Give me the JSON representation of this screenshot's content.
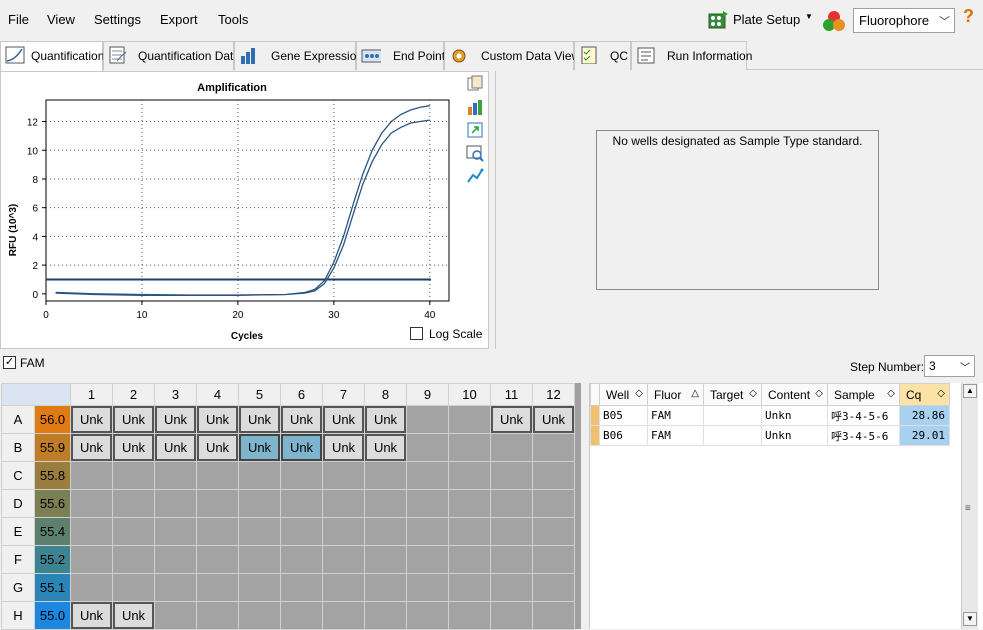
{
  "menu": {
    "file": "File",
    "view": "View",
    "settings": "Settings",
    "export": "Export",
    "tools": "Tools"
  },
  "toolbar": {
    "plate_setup": "Plate Setup",
    "fluorophore": "Fluorophore",
    "help": "?"
  },
  "tabs": [
    {
      "label": "Quantification"
    },
    {
      "label": "Quantification Data"
    },
    {
      "label": "Gene Expression"
    },
    {
      "label": "End Point"
    },
    {
      "label": "Custom Data View"
    },
    {
      "label": "QC"
    },
    {
      "label": "Run Information"
    }
  ],
  "chart": {
    "log_scale_label": "Log Scale"
  },
  "chart_data": {
    "type": "line",
    "title": "Amplification",
    "xlabel": "Cycles",
    "ylabel": "RFU (10^3)",
    "xlim": [
      0,
      42
    ],
    "ylim": [
      -0.5,
      13.5
    ],
    "xticks": [
      0,
      10,
      20,
      30,
      40
    ],
    "yticks": [
      0,
      2,
      4,
      6,
      8,
      10,
      12
    ],
    "threshold": 1.0,
    "series": [
      {
        "x": [
          1,
          5,
          10,
          15,
          20,
          25,
          27,
          28,
          29,
          30,
          31,
          32,
          33,
          34,
          35,
          36,
          37,
          38,
          39,
          40
        ],
        "y": [
          0.05,
          -0.05,
          -0.1,
          -0.1,
          -0.1,
          -0.05,
          0.1,
          0.3,
          0.9,
          2.2,
          4.0,
          6.2,
          8.3,
          10.0,
          11.2,
          12.0,
          12.5,
          12.8,
          13.0,
          13.1
        ]
      },
      {
        "x": [
          1,
          5,
          10,
          15,
          20,
          25,
          27,
          28,
          29,
          30,
          31,
          32,
          33,
          34,
          35,
          36,
          37,
          38,
          39,
          40
        ],
        "y": [
          0.1,
          0.0,
          -0.05,
          -0.08,
          -0.08,
          -0.05,
          0.05,
          0.2,
          0.7,
          1.8,
          3.4,
          5.5,
          7.6,
          9.2,
          10.4,
          11.2,
          11.6,
          11.9,
          12.0,
          12.1
        ]
      }
    ]
  },
  "standard_box": {
    "message": "No wells designated as Sample Type standard."
  },
  "fam_bar": {
    "fam_label": "FAM",
    "step_label": "Step Number:",
    "step_value": "3"
  },
  "plate": {
    "columns": [
      "1",
      "2",
      "3",
      "4",
      "5",
      "6",
      "7",
      "8",
      "9",
      "10",
      "11",
      "12"
    ],
    "rows": [
      {
        "label": "A",
        "temp": "56.0",
        "color": "#e07b14",
        "wells": [
          "Unk",
          "Unk",
          "Unk",
          "Unk",
          "Unk",
          "Unk",
          "Unk",
          "Unk",
          "",
          "",
          "Unk",
          "Unk"
        ]
      },
      {
        "label": "B",
        "temp": "55.9",
        "color": "#bf7d28",
        "wells": [
          "Unk",
          "Unk",
          "Unk",
          "Unk",
          "Unk",
          "Unk",
          "Unk",
          "Unk",
          "",
          "",
          "",
          ""
        ]
      },
      {
        "label": "C",
        "temp": "55.8",
        "color": "#997e3d",
        "wells": [
          "",
          "",
          "",
          "",
          "",
          "",
          "",
          "",
          "",
          "",
          "",
          ""
        ]
      },
      {
        "label": "D",
        "temp": "55.6",
        "color": "#7b7f54",
        "wells": [
          "",
          "",
          "",
          "",
          "",
          "",
          "",
          "",
          "",
          "",
          "",
          ""
        ]
      },
      {
        "label": "E",
        "temp": "55.4",
        "color": "#5d7f6d",
        "wells": [
          "",
          "",
          "",
          "",
          "",
          "",
          "",
          "",
          "",
          "",
          "",
          ""
        ]
      },
      {
        "label": "F",
        "temp": "55.2",
        "color": "#3d8490",
        "wells": [
          "",
          "",
          "",
          "",
          "",
          "",
          "",
          "",
          "",
          "",
          "",
          ""
        ]
      },
      {
        "label": "G",
        "temp": "55.1",
        "color": "#2a84b5",
        "wells": [
          "",
          "",
          "",
          "",
          "",
          "",
          "",
          "",
          "",
          "",
          "",
          ""
        ]
      },
      {
        "label": "H",
        "temp": "55.0",
        "color": "#1c86e0",
        "wells": [
          "Unk",
          "Unk",
          "",
          "",
          "",
          "",
          "",
          "",
          "",
          "",
          "",
          ""
        ]
      }
    ],
    "selected": [
      [
        1,
        4
      ],
      [
        1,
        5
      ]
    ]
  },
  "results": {
    "headers": [
      "Well",
      "Fluor",
      "Target",
      "Content",
      "Sample",
      "Cq"
    ],
    "rows": [
      [
        "B05",
        "FAM",
        "",
        "Unkn",
        "呼3-4-5-6",
        "28.86"
      ],
      [
        "B06",
        "FAM",
        "",
        "Unkn",
        "呼3-4-5-6",
        "29.01"
      ]
    ]
  }
}
